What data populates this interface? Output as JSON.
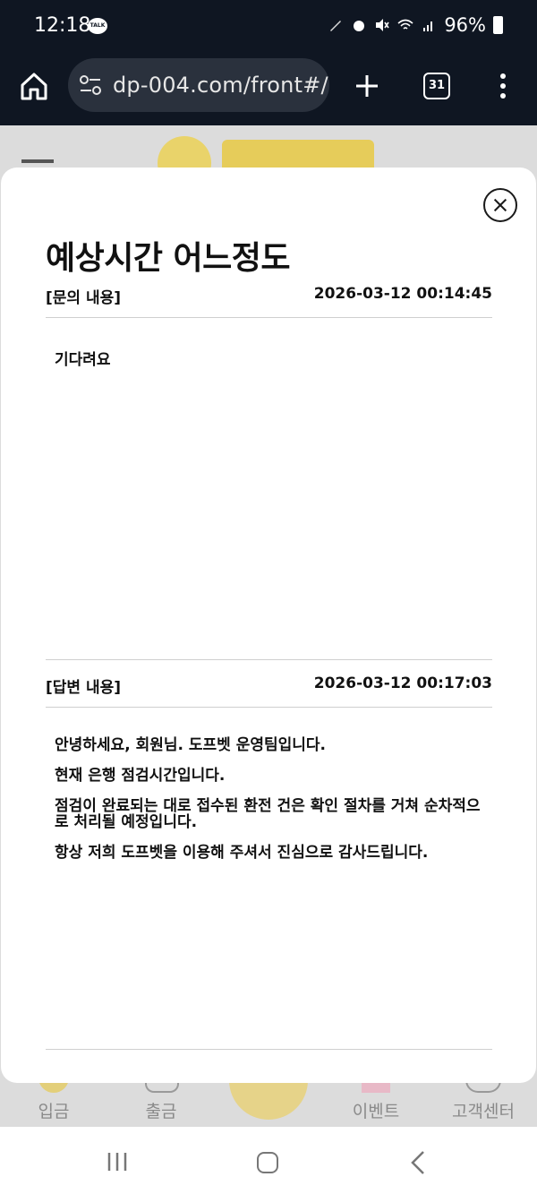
{
  "status_bar": {
    "time": "12:18",
    "talk_badge": "TALK",
    "battery": "96%"
  },
  "browser": {
    "url": "dp-004.com/front#/",
    "tab_count": "31"
  },
  "modal": {
    "title": "예상시간 어느정도",
    "question_label": "[문의 내용]",
    "question_date": "2026-03-12 00:14:45",
    "question_body": "기다려요",
    "answer_label": "[답변 내용]",
    "answer_date": "2026-03-12 00:17:03",
    "answer_lines": [
      "안녕하세요, 회원님. 도프벳 운영팀입니다.",
      "현재 은행 점검시간입니다.",
      "점검이 완료되는 대로 접수된 환전 건은 확인 절차를 거쳐 순차적으로 처리될 예정입니다.",
      "항상 저희 도프벳을 이용해 주셔서 진심으로 감사드립니다."
    ]
  },
  "bottom_nav": {
    "deposit": "입금",
    "withdraw": "출금",
    "event": "이벤트",
    "support": "고객센터"
  }
}
